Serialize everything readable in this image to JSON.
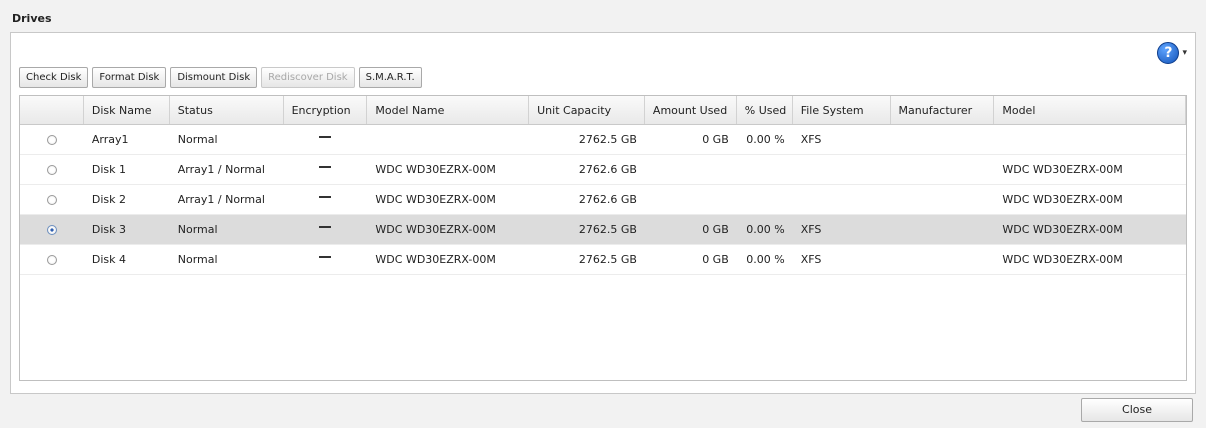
{
  "dialog": {
    "title": "Drives",
    "close_label": "Close",
    "help_icon": "?"
  },
  "toolbar": {
    "check_disk": "Check Disk",
    "format_disk": "Format Disk",
    "dismount_disk": "Dismount Disk",
    "rediscover_disk": "Rediscover Disk",
    "smart": "S.M.A.R.T."
  },
  "table": {
    "headers": [
      "",
      "Disk Name",
      "Status",
      "Encryption",
      "Model Name",
      "Unit Capacity",
      "Amount Used",
      "% Used",
      "File System",
      "Manufacturer",
      "Model"
    ],
    "rows": [
      {
        "selected": false,
        "disk_name": "Array1",
        "status": "Normal",
        "encryption": "—",
        "model_name": "",
        "unit_capacity": "2762.5 GB",
        "amount_used": "0 GB",
        "percent_used": "0.00 %",
        "file_system": "XFS",
        "manufacturer": "",
        "model": ""
      },
      {
        "selected": false,
        "disk_name": "Disk 1",
        "status": "Array1 / Normal",
        "encryption": "—",
        "model_name": "WDC WD30EZRX-00M",
        "unit_capacity": "2762.6 GB",
        "amount_used": "",
        "percent_used": "",
        "file_system": "",
        "manufacturer": "",
        "model": "WDC WD30EZRX-00M"
      },
      {
        "selected": false,
        "disk_name": "Disk 2",
        "status": "Array1 / Normal",
        "encryption": "—",
        "model_name": "WDC WD30EZRX-00M",
        "unit_capacity": "2762.6 GB",
        "amount_used": "",
        "percent_used": "",
        "file_system": "",
        "manufacturer": "",
        "model": "WDC WD30EZRX-00M"
      },
      {
        "selected": true,
        "disk_name": "Disk 3",
        "status": "Normal",
        "encryption": "—",
        "model_name": "WDC WD30EZRX-00M",
        "unit_capacity": "2762.5 GB",
        "amount_used": "0 GB",
        "percent_used": "0.00 %",
        "file_system": "XFS",
        "manufacturer": "",
        "model": "WDC WD30EZRX-00M"
      },
      {
        "selected": false,
        "disk_name": "Disk 4",
        "status": "Normal",
        "encryption": "—",
        "model_name": "WDC WD30EZRX-00M",
        "unit_capacity": "2762.5 GB",
        "amount_used": "0 GB",
        "percent_used": "0.00 %",
        "file_system": "XFS",
        "manufacturer": "",
        "model": "WDC WD30EZRX-00M"
      }
    ]
  },
  "icons": {
    "help": "help-icon",
    "dropdown": "chevron-down-icon"
  },
  "colors": {
    "selected_row": "#dcdcdc",
    "help_blue": "#1353b8"
  }
}
